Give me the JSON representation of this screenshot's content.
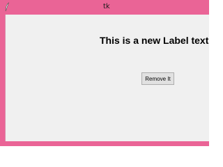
{
  "window": {
    "title": "tk",
    "app_icon": "feather-icon",
    "frame_color": "#ea6496",
    "client_color": "#f0f0f0"
  },
  "content": {
    "label_text": "This is a new Label text",
    "button_label": "Remove It"
  }
}
